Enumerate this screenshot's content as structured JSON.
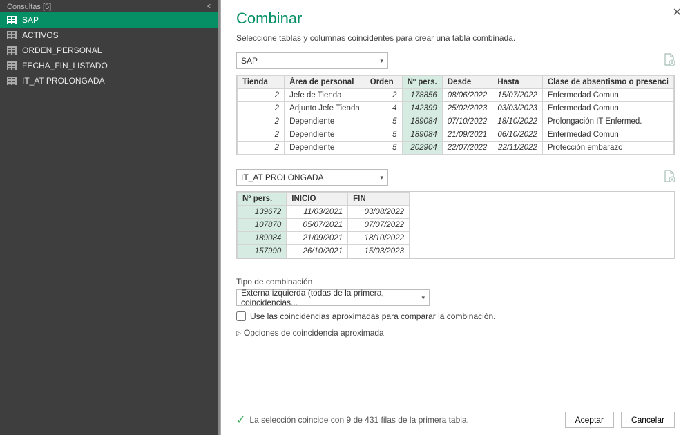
{
  "sidebar": {
    "header": "Consultas [5]",
    "items": [
      {
        "label": "SAP",
        "active": true
      },
      {
        "label": "ACTIVOS",
        "active": false
      },
      {
        "label": "ORDEN_PERSONAL",
        "active": false
      },
      {
        "label": "FECHA_FIN_LISTADO",
        "active": false
      },
      {
        "label": "IT_AT PROLONGADA",
        "active": false
      }
    ]
  },
  "dialog": {
    "title": "Combinar",
    "subtitle": "Seleccione tablas y columnas coincidentes para crear una tabla combinada.",
    "table1_select": "SAP",
    "table1": {
      "headers": [
        "Tienda",
        "Área de personal",
        "Orden",
        "Nº pers.",
        "Desde",
        "Hasta",
        "Clase de absentismo o presenci"
      ],
      "rows": [
        [
          "2",
          "Jefe de Tienda",
          "2",
          "178856",
          "08/06/2022",
          "15/07/2022",
          "Enfermedad Comun"
        ],
        [
          "2",
          "Adjunto Jefe Tienda",
          "4",
          "142399",
          "25/02/2023",
          "03/03/2023",
          "Enfermedad Comun"
        ],
        [
          "2",
          "Dependiente",
          "5",
          "189084",
          "07/10/2022",
          "18/10/2022",
          "Prolongación IT Enfermed."
        ],
        [
          "2",
          "Dependiente",
          "5",
          "189084",
          "21/09/2021",
          "06/10/2022",
          "Enfermedad Comun"
        ],
        [
          "2",
          "Dependiente",
          "5",
          "202904",
          "22/07/2022",
          "22/11/2022",
          "Protección embarazo"
        ]
      ]
    },
    "table2_select": "IT_AT PROLONGADA",
    "table2": {
      "headers": [
        "Nº pers.",
        "INICIO",
        "FIN"
      ],
      "rows": [
        [
          "139672",
          "11/03/2021",
          "03/08/2022"
        ],
        [
          "107870",
          "05/07/2021",
          "07/07/2022"
        ],
        [
          "189084",
          "21/09/2021",
          "18/10/2022"
        ],
        [
          "157990",
          "26/10/2021",
          "15/03/2023"
        ]
      ]
    },
    "join_label": "Tipo de combinación",
    "join_select": "Externa izquierda (todas de la primera, coincidencias...",
    "fuzzy_checkbox": "Use las coincidencias aproximadas para comparar la combinación.",
    "fuzzy_options": "Opciones de coincidencia aproximada",
    "match_message": "La selección coincide con 9 de 431 filas de la primera tabla.",
    "ok_label": "Aceptar",
    "cancel_label": "Cancelar"
  }
}
